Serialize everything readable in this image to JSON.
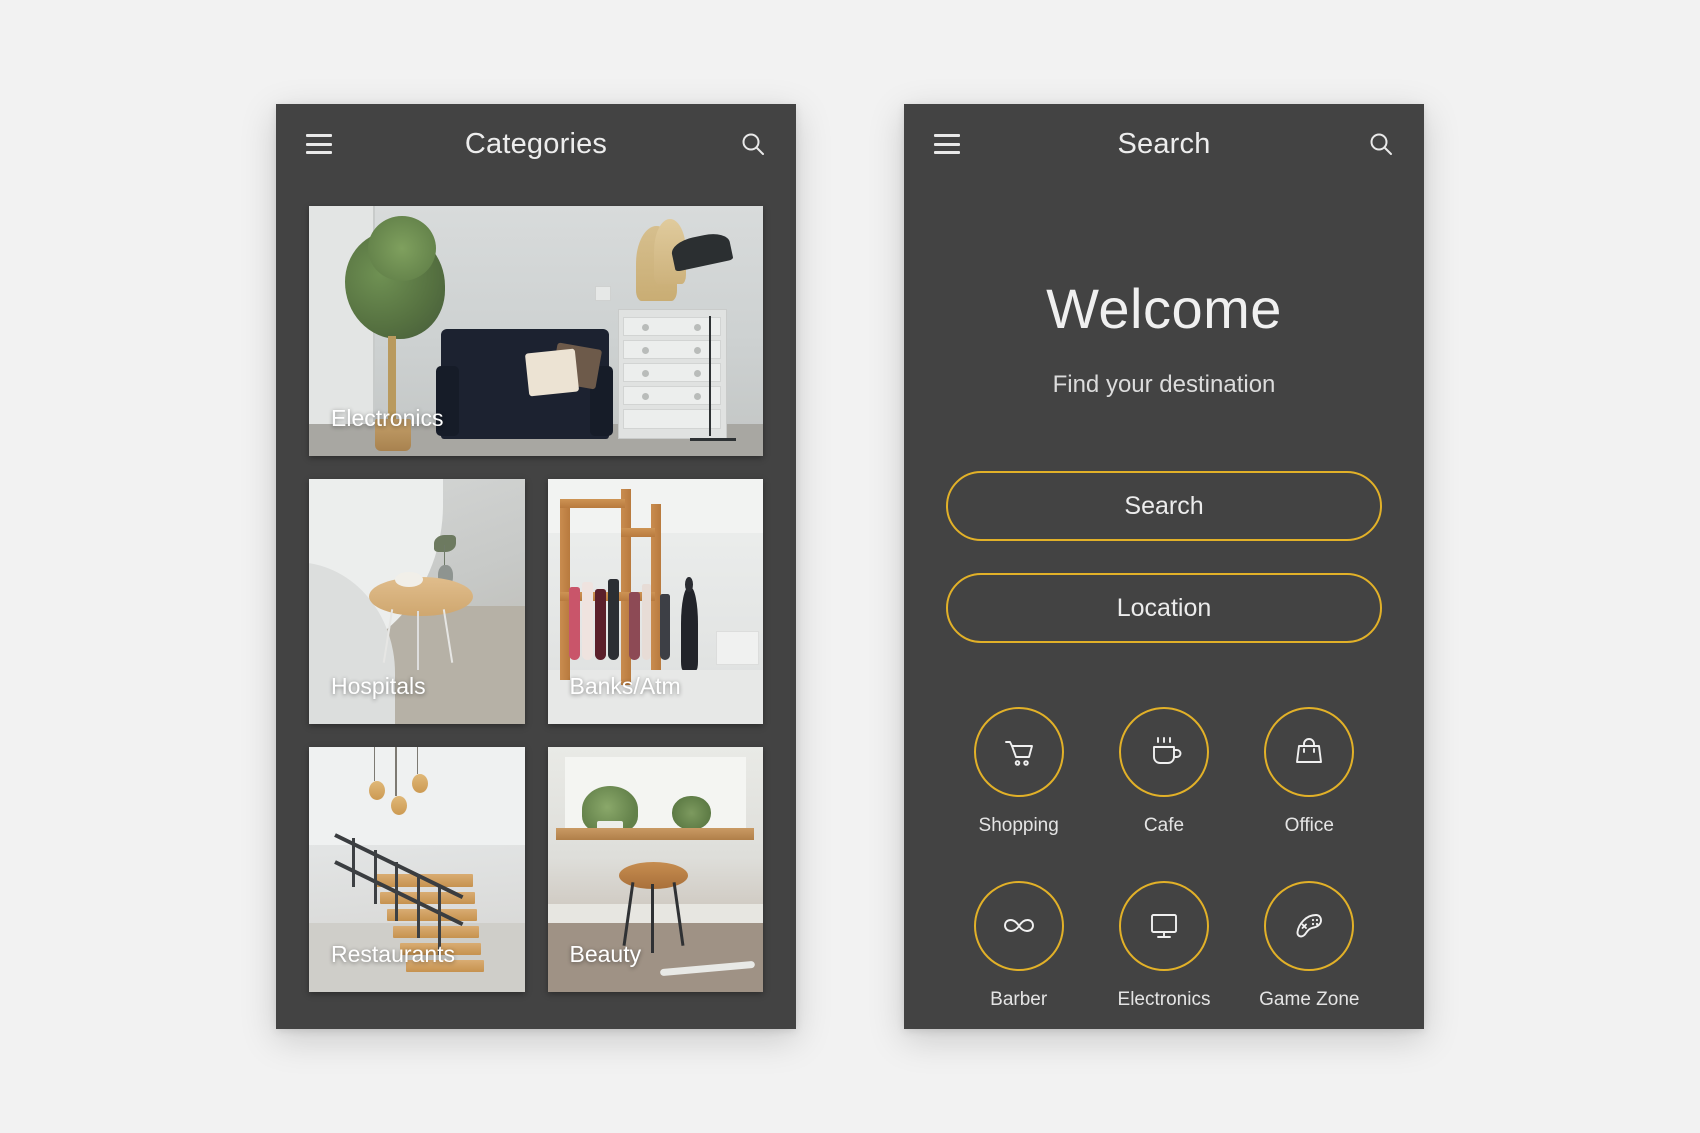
{
  "theme": {
    "page_background": "#f2f2f2",
    "panel_background": "#434343",
    "accent": "#e2b128",
    "text_primary": "#ededed"
  },
  "categories_screen": {
    "header": {
      "menu_icon": "hamburger-menu-icon",
      "title": "Categories",
      "search_icon": "search-icon"
    },
    "cards": [
      {
        "label": "Electronics",
        "photo": "living-room-sofa-plant-dresser-lamp"
      },
      {
        "label": "Hospitals",
        "photo": "curved-white-interior-wooden-round-table"
      },
      {
        "label": "Banks/Atm",
        "photo": "clothing-store-wooden-racks"
      },
      {
        "label": "Restaurants",
        "photo": "wooden-staircase-with-railing"
      },
      {
        "label": "Beauty",
        "photo": "wooden-stool-plants-window"
      }
    ]
  },
  "search_screen": {
    "header": {
      "menu_icon": "hamburger-menu-icon",
      "title": "Search",
      "search_icon": "search-icon"
    },
    "welcome_title": "Welcome",
    "subtitle": "Find your destination",
    "buttons": [
      {
        "label": "Search"
      },
      {
        "label": "Location"
      }
    ],
    "tiles": [
      {
        "label": "Shopping",
        "icon": "shopping-cart-icon"
      },
      {
        "label": "Cafe",
        "icon": "coffee-cup-icon"
      },
      {
        "label": "Office",
        "icon": "briefcase-icon"
      },
      {
        "label": "Barber",
        "icon": "mustache-icon"
      },
      {
        "label": "Electronics",
        "icon": "monitor-icon"
      },
      {
        "label": "Game Zone",
        "icon": "gamepad-icon"
      }
    ]
  }
}
